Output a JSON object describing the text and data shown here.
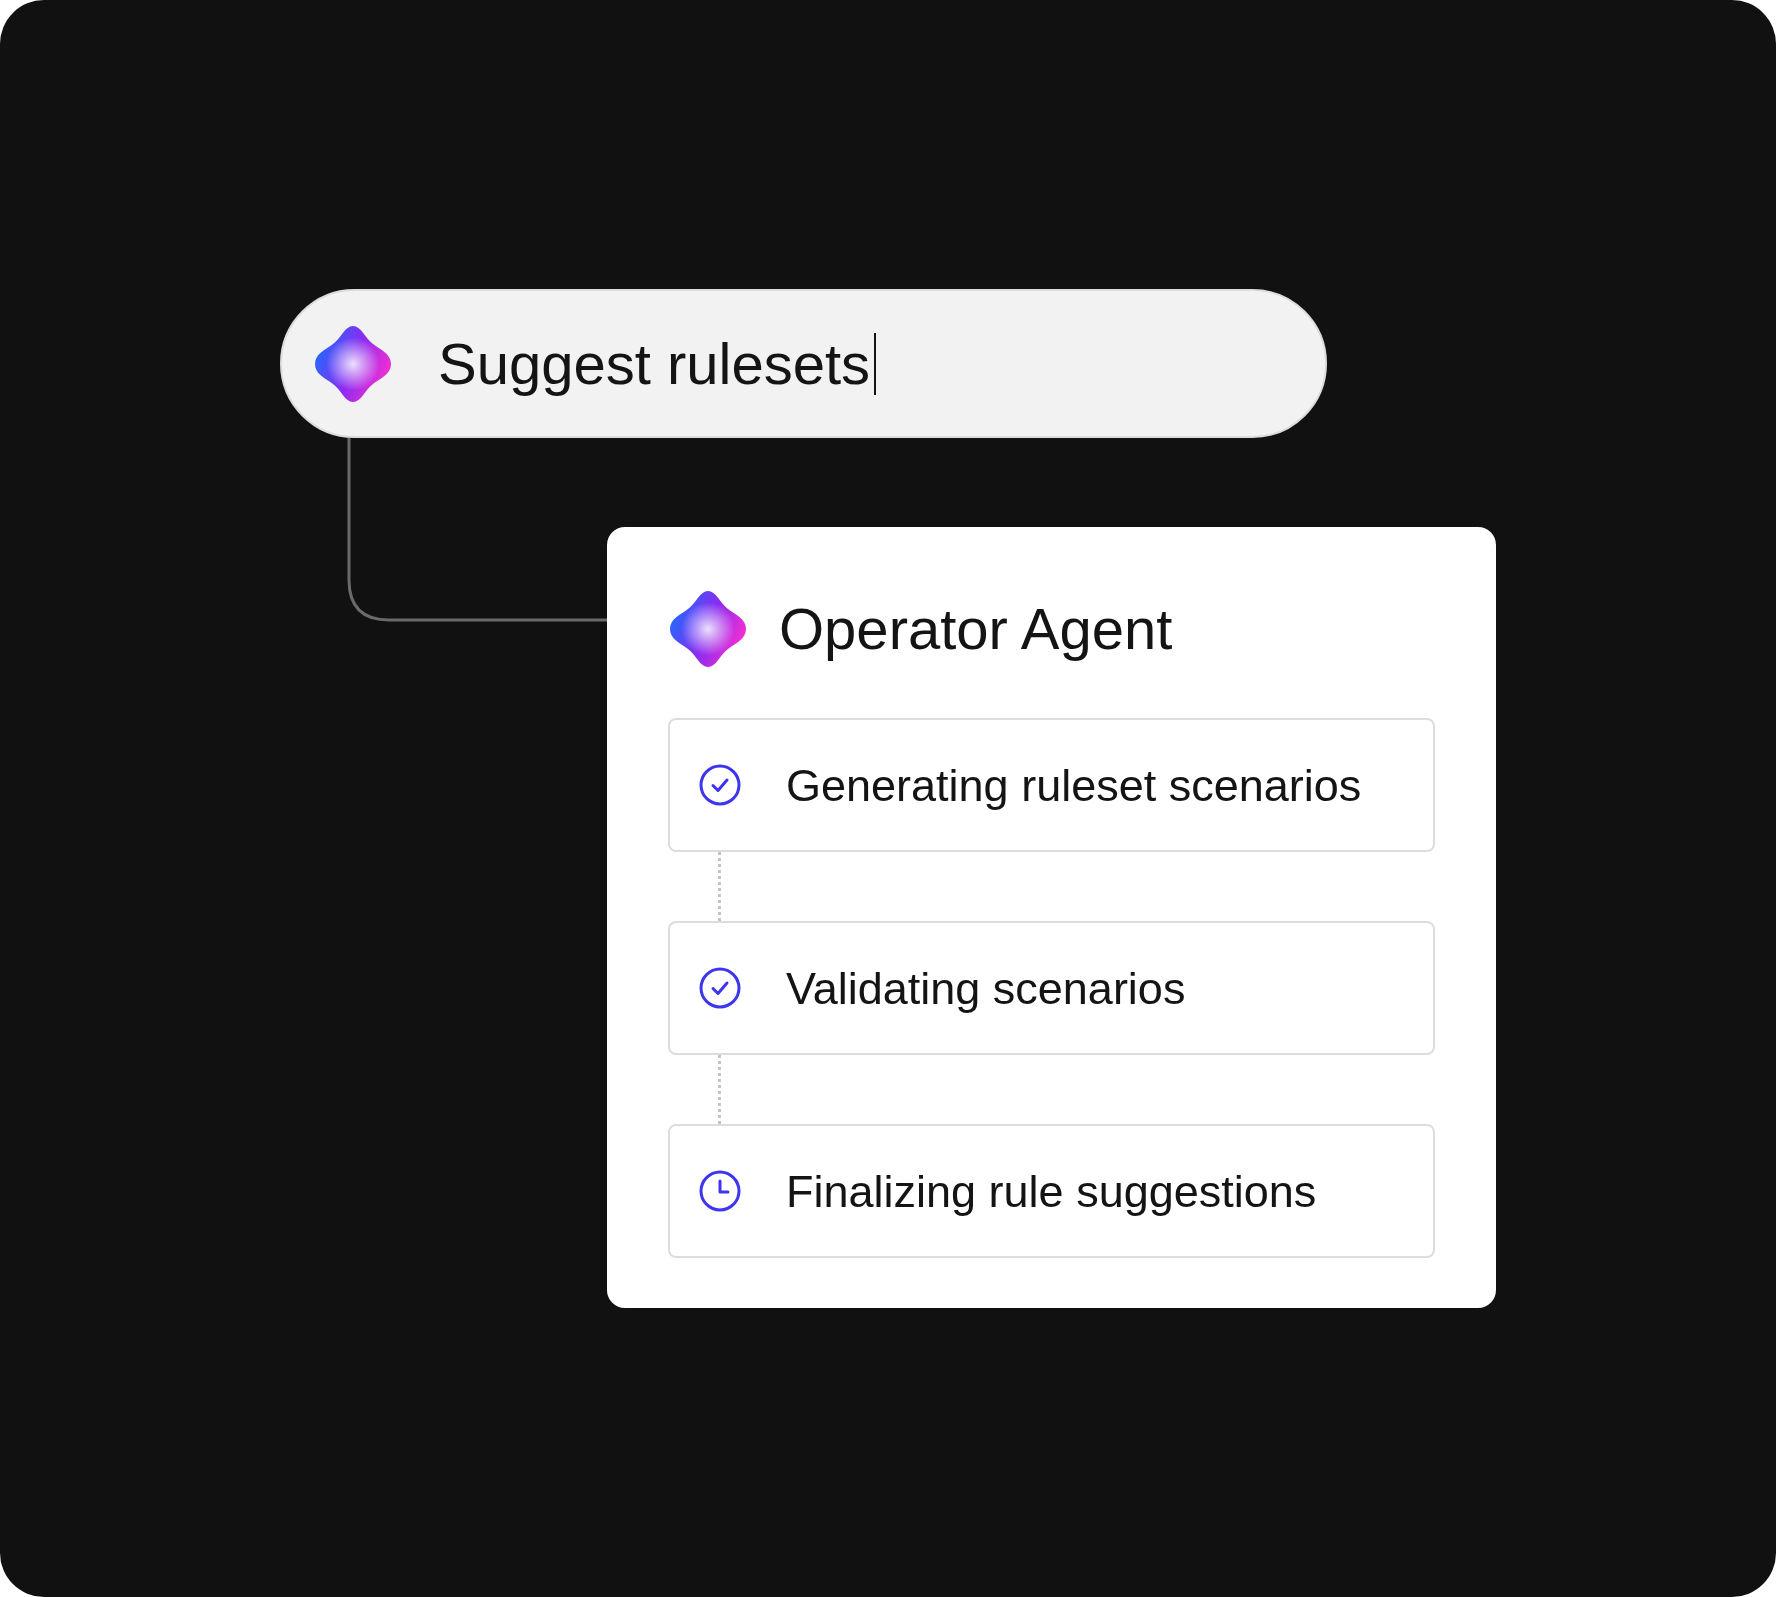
{
  "prompt": {
    "text": "Suggest rulesets",
    "focused": true
  },
  "agent": {
    "title": "Operator Agent",
    "steps": [
      {
        "label": "Generating ruleset scenarios",
        "done": true
      },
      {
        "label": "Validating scenarios",
        "done": true
      },
      {
        "label": "Finalizing rule suggestions",
        "done": false
      }
    ]
  }
}
